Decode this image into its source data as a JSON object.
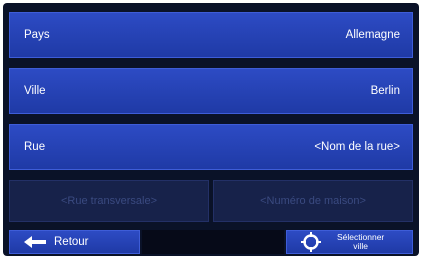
{
  "fields": [
    {
      "label": "Pays",
      "value": "Allemagne"
    },
    {
      "label": "Ville",
      "value": "Berlin"
    },
    {
      "label": "Rue",
      "value": "<Nom de la rue>"
    }
  ],
  "disabled_fields": {
    "cross_street": "<Rue transversale>",
    "house_number": "<Numéro de maison>"
  },
  "bottom_bar": {
    "back_label": "Retour",
    "back_icon": "arrow-left-icon",
    "select_label": "Sélectionner\nville",
    "select_icon": "crosshair-target-icon"
  },
  "colors": {
    "button_blue": "#2d4bc4",
    "background": "#0a1228",
    "disabled": "#17224a"
  }
}
